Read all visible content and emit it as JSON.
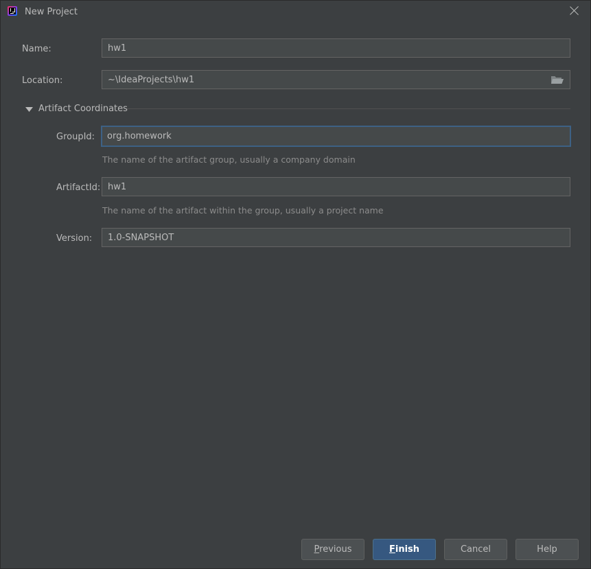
{
  "window": {
    "title": "New Project"
  },
  "icons": {
    "app": "intellij-idea-icon",
    "close": "close-icon",
    "folder": "folder-icon",
    "section_toggle": "triangle-down-icon"
  },
  "form": {
    "name": {
      "label": "Name:",
      "value": "hw1"
    },
    "location": {
      "label": "Location:",
      "value": "~\\IdeaProjects\\hw1"
    },
    "section": {
      "label": "Artifact Coordinates",
      "expanded": true
    },
    "group_id": {
      "label": "GroupId:",
      "value": "org.homework",
      "hint": "The name of the artifact group, usually a company domain"
    },
    "artifact_id": {
      "label": "ArtifactId:",
      "value": "hw1",
      "hint": "The name of the artifact within the group, usually a project name"
    },
    "version": {
      "label": "Version:",
      "value": "1.0-SNAPSHOT"
    }
  },
  "buttons": {
    "previous": {
      "mnemonic": "P",
      "rest": "revious"
    },
    "finish": {
      "mnemonic": "F",
      "rest": "inish"
    },
    "cancel": "Cancel",
    "help": "Help"
  },
  "colors": {
    "background": "#3c3f41",
    "field_background": "#45494a",
    "focus_border": "#3d6185",
    "primary_button": "#365880",
    "text": "#bbbbbb",
    "hint_text": "#8c8c8c"
  }
}
